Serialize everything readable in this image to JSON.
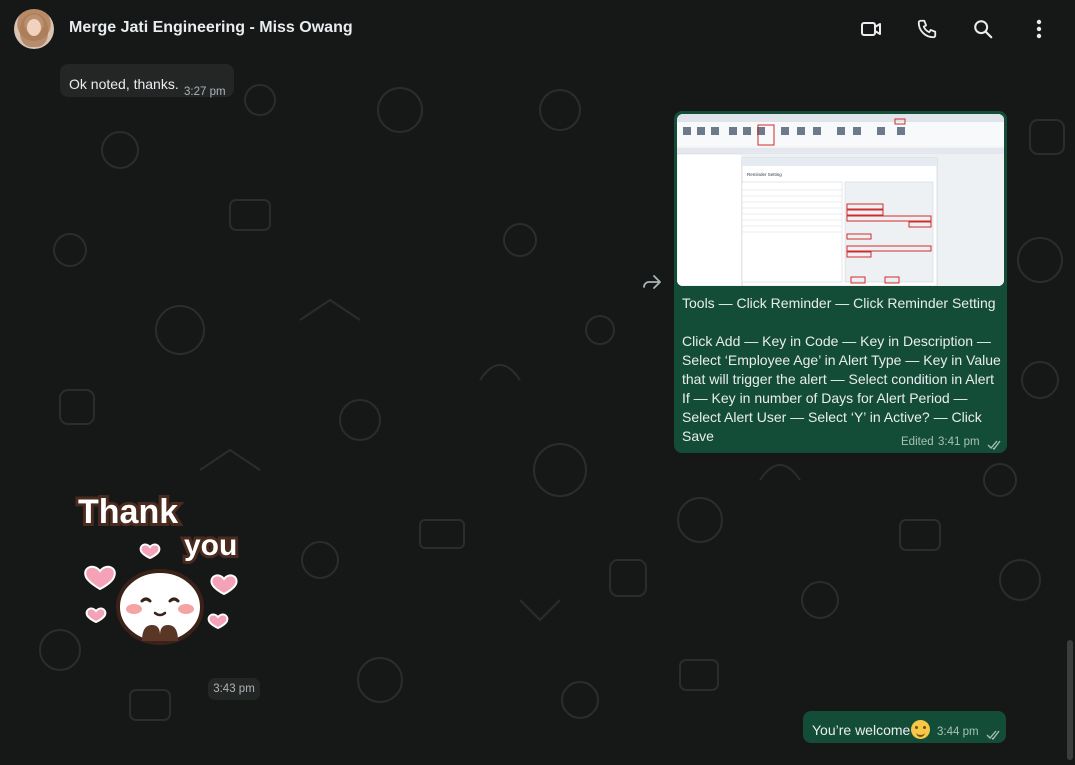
{
  "header": {
    "title": "Merge Jati Engineering - Miss Owang",
    "icons": [
      "video-call-icon",
      "voice-call-icon",
      "search-icon",
      "more-options-icon"
    ]
  },
  "messages": {
    "incoming_text": {
      "text": "Ok noted, thanks.",
      "time": "3:27 pm"
    },
    "outgoing_image": {
      "caption": "Tools — Click Reminder — Click Reminder Setting\n\nClick Add — Key in Code — Key in Description — Select ‘Employee Age’ in Alert Type — Key in Value that will trigger the alert — Select condition in Alert If — Key in number of Days for Alert Period — Select Alert User — Select ‘Y’ in Active? — Click Save",
      "edited_label": "Edited",
      "time": "3:41 pm",
      "screenshot_title": "Reminder Setting"
    },
    "incoming_sticker": {
      "line1": "Thank",
      "line2": "you",
      "time": "3:43 pm"
    },
    "outgoing_text": {
      "text": "You’re welcome",
      "time": "3:44 pm"
    }
  },
  "colors": {
    "background": "#161717",
    "incoming_bubble": "#242626",
    "outgoing_bubble": "#144d37"
  }
}
